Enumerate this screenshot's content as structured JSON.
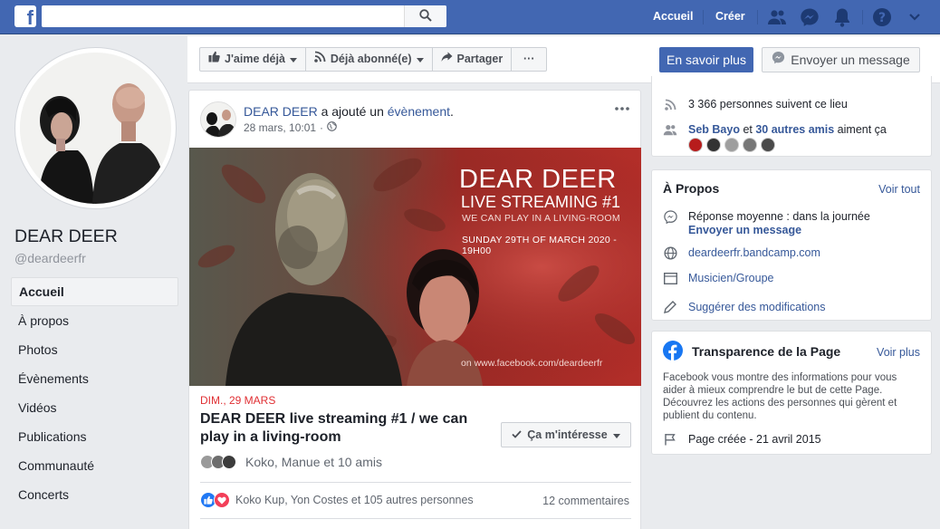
{
  "topbar": {
    "logo": "f",
    "search_placeholder": "",
    "home_label": "Accueil",
    "create_label": "Créer",
    "icons": [
      "friends-icon",
      "messenger-icon",
      "notifications-icon",
      "help-icon",
      "account-menu-icon"
    ]
  },
  "profile": {
    "name": "DEAR DEER",
    "handle": "@deardeerfr"
  },
  "left_nav": {
    "items": [
      {
        "label": "Accueil",
        "active": true
      },
      {
        "label": "À propos"
      },
      {
        "label": "Photos"
      },
      {
        "label": "Évènements"
      },
      {
        "label": "Vidéos"
      },
      {
        "label": "Publications"
      },
      {
        "label": "Communauté"
      },
      {
        "label": "Concerts"
      }
    ]
  },
  "action_bar": {
    "like_label": "J'aime déjà",
    "follow_label": "Déjà abonné(e)",
    "share_label": "Partager",
    "more_label": "···",
    "cta_label": "En savoir plus",
    "message_label": "Envoyer un message"
  },
  "post": {
    "author": "DEAR DEER",
    "action_text": " a ajouté un ",
    "object_link": "évènement",
    "object_suffix": ".",
    "timestamp": "28 mars, 10:01",
    "privacy_icon": "globe-icon",
    "banner": {
      "title": "DEAR DEER",
      "subtitle": "LIVE STREAMING #1",
      "tagline": "WE CAN PLAY IN A LIVING-ROOM",
      "date": "SUNDAY 29TH OF MARCH 2020 - 19H00",
      "url": "on www.facebook.com/deardeerfr"
    },
    "event_date": "DIM., 29 MARS",
    "event_title": "DEAR DEER live streaming #1 / we can play in a living-room",
    "interest_label": "Ça m'intéresse",
    "friends_text": "Koko, Manue et 10 amis",
    "reactions_text": "Koko Kup, Yon Costes et 105 autres personnes",
    "comments_text": "12 commentaires"
  },
  "stats_card": {
    "followers": "3 366 personnes suivent ce lieu",
    "likes_name": "Seb Bayo",
    "likes_and": " et ",
    "likes_others": "30 autres amis",
    "likes_suffix": " aiment ça"
  },
  "about_card": {
    "title": "À Propos",
    "see_all": "Voir tout",
    "response_time": "Réponse moyenne : dans la journée",
    "send_message": "Envoyer un message",
    "website": "deardeerfr.bandcamp.com",
    "category": "Musicien/Groupe",
    "suggest": "Suggérer des modifications"
  },
  "transparency_card": {
    "title": "Transparence de la Page",
    "see_more": "Voir plus",
    "text": "Facebook vous montre des informations pour vous aider à mieux comprendre le but de cette Page. Découvrez les actions des personnes qui gèrent et publient du contenu.",
    "created": "Page créée - 21 avril 2015"
  },
  "colors": {
    "brand": "#4267b2",
    "link": "#365899",
    "event_red": "#e02f33"
  }
}
